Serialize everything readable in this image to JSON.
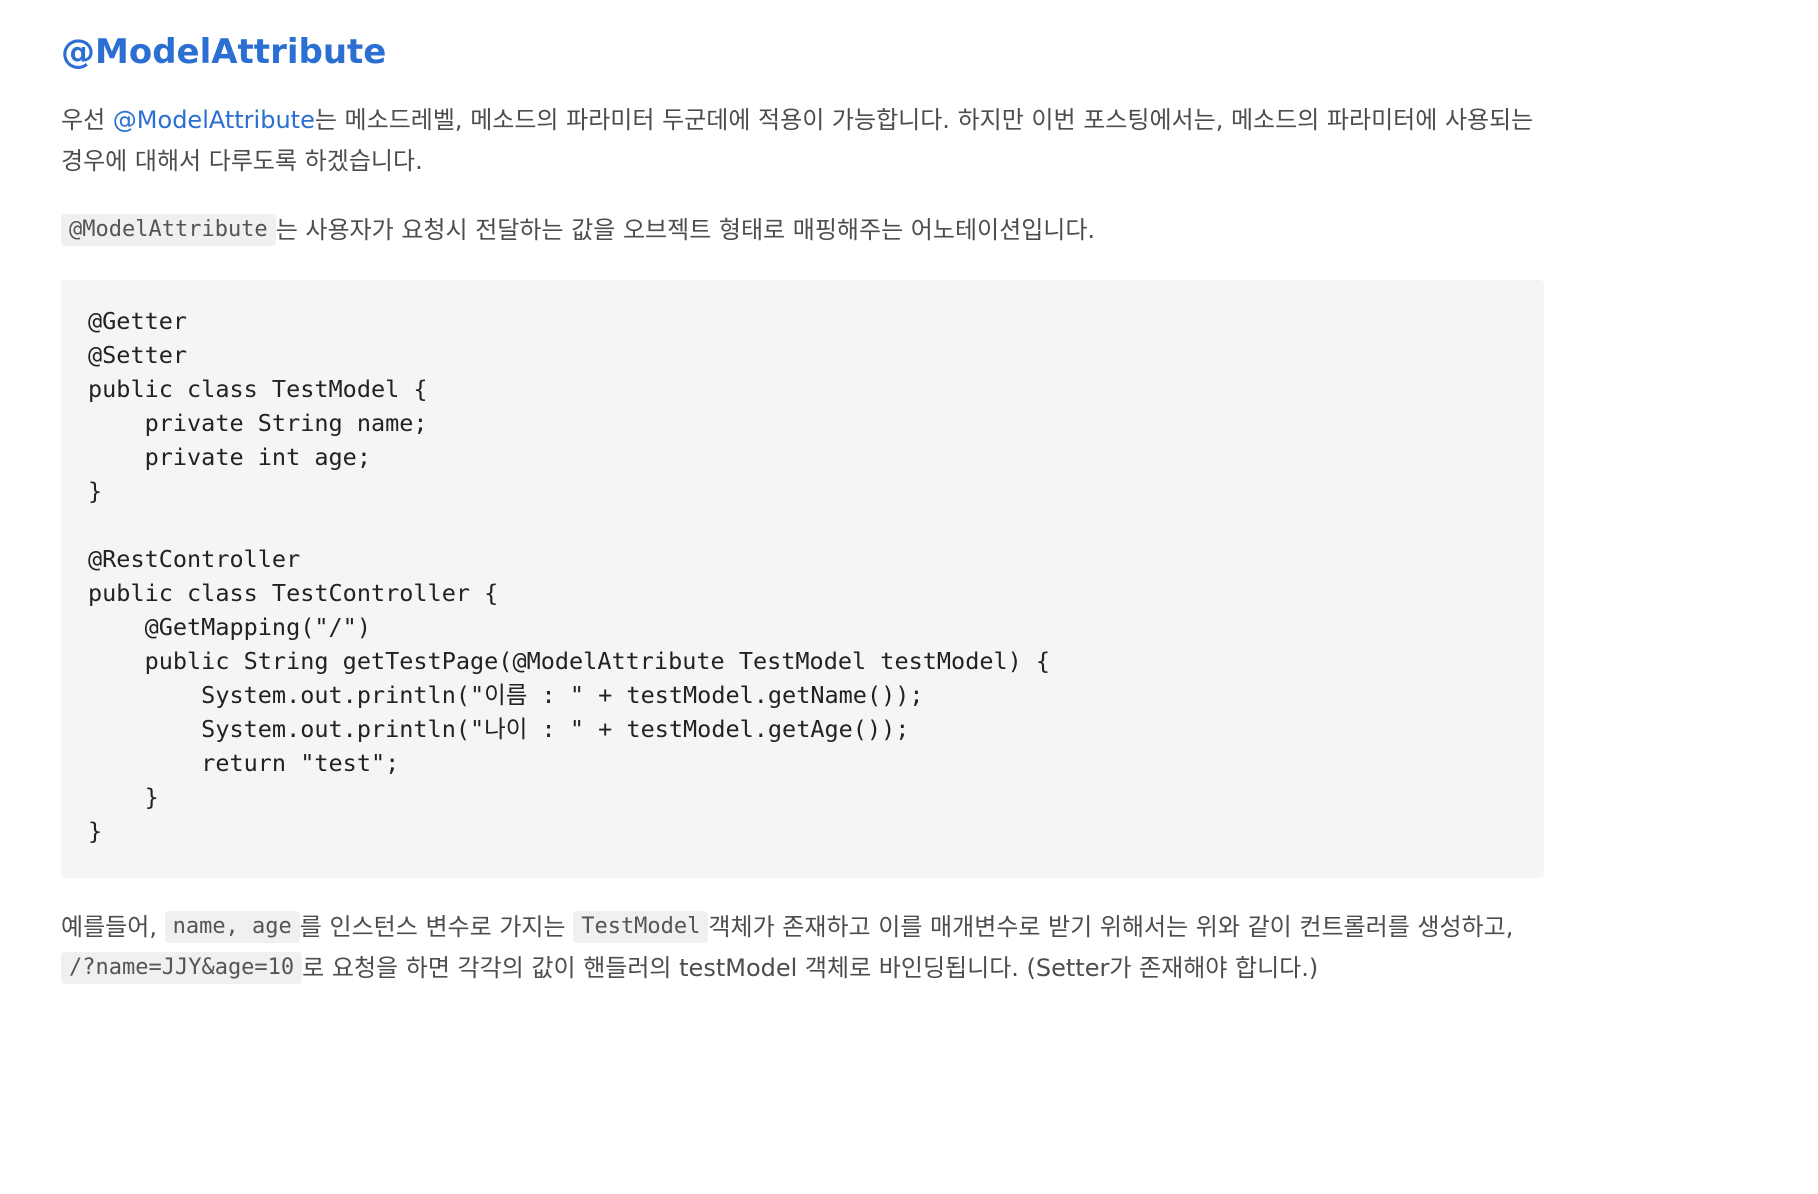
{
  "heading": "@ModelAttribute",
  "para1": {
    "prefix": "우선 ",
    "link_text": "@ModelAttribute",
    "line1_rest": "는 메소드레벨, 메소드의 파라미터 두군데에 적용이 가능합니다. 하지만 이번 포스팅에서는, 메소드의 파라미터에 사용되는",
    "line2": "경우에 대해서 다루도록 하겠습니다."
  },
  "para2": {
    "code": "@ModelAttribute",
    "text": "는 사용자가 요청시 전달하는 값을 오브젝트 형태로 매핑해주는 어노테이션입니다."
  },
  "code_block": "@Getter\n@Setter\npublic class TestModel {\n    private String name;\n    private int age;\n}\n\n@RestController\npublic class TestController {\n    @GetMapping(\"/\")\n    public String getTestPage(@ModelAttribute TestModel testModel) {\n        System.out.println(\"이름 : \" + testModel.getName());\n        System.out.println(\"나이 : \" + testModel.getAge());\n        return \"test\";\n    }\n}",
  "para3": {
    "prefix": "예를들어, ",
    "code1": "name, age",
    "text1": "를 인스턴스 변수로 가지는 ",
    "code2": "TestModel",
    "text2": "객체가 존재하고 이를 매개변수로 받기 위해서는 위와 같이 컨트롤러를 생성하고,",
    "code3": "/?name=JJY&age=10",
    "text3": "로 요청을 하면 각각의 값이 핸들러의 testModel 객체로 바인딩됩니다. (Setter가 존재해야 합니다.)"
  },
  "colors": {
    "heading": "#2a6fd1",
    "link": "#2a6fd1",
    "body_text": "#4d4d4d",
    "code_background": "#f5f5f6",
    "inline_code_background": "#f0f0f0"
  }
}
